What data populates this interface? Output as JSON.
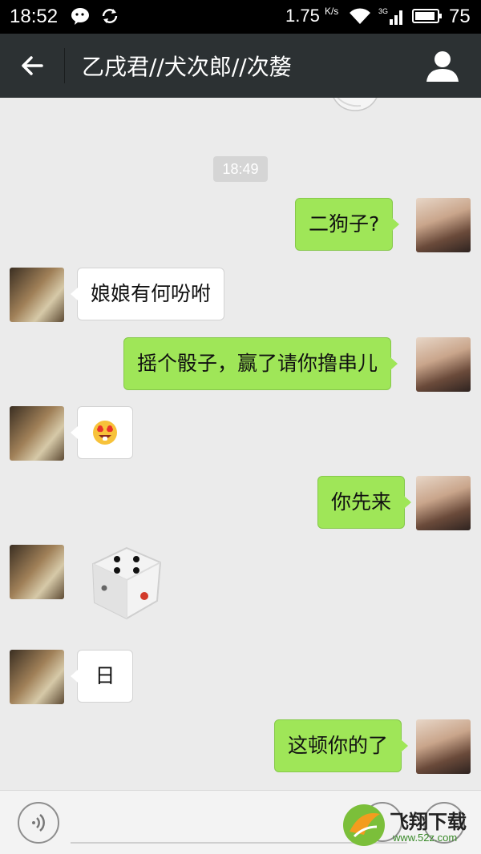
{
  "status_bar": {
    "time": "18:52",
    "speed": "1.75",
    "speed_unit": "K/s",
    "network": "3G",
    "battery": "75"
  },
  "header": {
    "title": "乙戌君//犬次郎//次嫠"
  },
  "chat": {
    "timestamp": "18:49",
    "messages": [
      {
        "from": "me",
        "text": "二狗子?"
      },
      {
        "from": "them",
        "text": "娘娘有何吩咐"
      },
      {
        "from": "me",
        "text": "摇个骰子，赢了请你撸串儿"
      },
      {
        "from": "them",
        "text": ""
      },
      {
        "from": "me",
        "text": "你先来"
      },
      {
        "from": "them",
        "text": ""
      },
      {
        "from": "them",
        "text": "日"
      },
      {
        "from": "me",
        "text": "这顿你的了"
      }
    ]
  },
  "watermark": {
    "brand": "飞翔下载",
    "url": "www.52z.com"
  },
  "colors": {
    "status_bar": "#000000",
    "title_bar": "#2c3133",
    "chat_bg": "#ebebeb",
    "bubble_me": "#9fe658",
    "bubble_them": "#ffffff"
  }
}
